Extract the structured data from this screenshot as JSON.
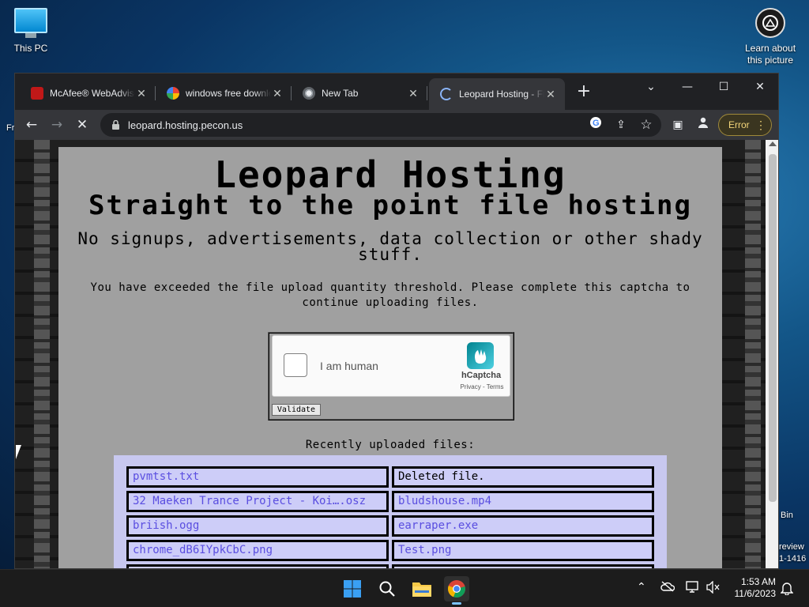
{
  "desktop": {
    "icons": {
      "this_pc": "This PC",
      "learn": "Learn about this picture"
    },
    "edge_left": "Fr",
    "edge_right": [
      "Bin",
      "review",
      "1-1416"
    ]
  },
  "browser": {
    "tabs": [
      {
        "title": "McAfee® WebAdvisor",
        "favicon": "mcafee-icon"
      },
      {
        "title": "windows free download",
        "favicon": "google-icon"
      },
      {
        "title": "New Tab",
        "favicon": "chrome-icon"
      },
      {
        "title": "Leopard Hosting - Fi",
        "favicon": "loading-icon",
        "active": true
      }
    ],
    "url": "leopard.hosting.pecon.us",
    "error_label": "Error"
  },
  "page": {
    "title": "Leopard Hosting",
    "subtitle": "Straight to the point file hosting",
    "tagline": "No signups, advertisements, data collection or other shady stuff.",
    "notice": "You have exceeded the file upload quantity threshold. Please complete this captcha to continue uploading files.",
    "captcha": {
      "label": "I am human",
      "brand": "hCaptcha",
      "links": "Privacy - Terms",
      "validate": "Validate"
    },
    "recent_heading": "Recently uploaded files:",
    "files": [
      [
        "pvmtst.txt",
        "Deleted file."
      ],
      [
        "32 Maeken Trance Project - Koi….osz",
        "bludshouse.mp4"
      ],
      [
        "briish.ogg",
        "earraper.exe"
      ],
      [
        "chrome_dB6IYpkCbC.png",
        "Test.png"
      ]
    ]
  },
  "taskbar": {
    "time": "1:53 AM",
    "date": "11/6/2023"
  },
  "colors": {
    "page_bg": "#a0a0a0",
    "file_panel": "#c8c8f0",
    "link": "#5a4ee0",
    "error_text": "#f4d67a"
  }
}
